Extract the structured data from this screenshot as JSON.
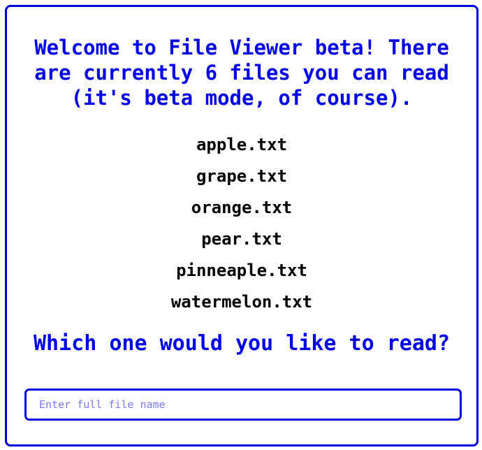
{
  "welcome_text": "Welcome to File Viewer beta! There are currently 6 files you can read (it's beta mode, of course).",
  "files": [
    "apple.txt",
    "grape.txt",
    "orange.txt",
    "pear.txt",
    "pinneaple.txt",
    "watermelon.txt"
  ],
  "question": "Which one would you like to read?",
  "input": {
    "placeholder": "Enter full file name",
    "value": ""
  },
  "colors": {
    "accent": "#0000e6",
    "border": "#0000dd",
    "placeholder": "#7a7aee",
    "text": "#000000"
  }
}
